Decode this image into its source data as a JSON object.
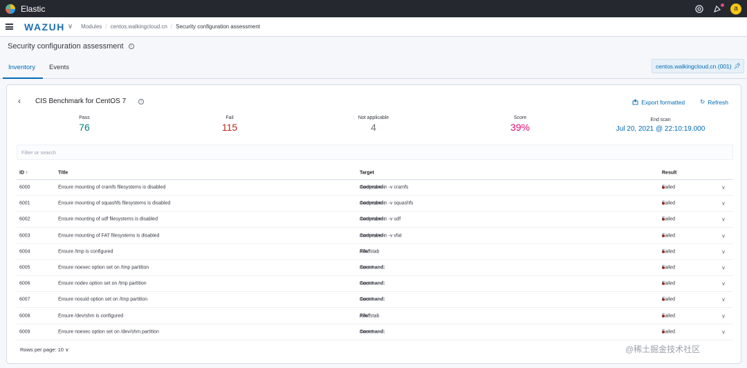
{
  "topbar": {
    "title": "Elastic",
    "avatar_initial": "a"
  },
  "header": {
    "brand": "WAZUH",
    "breadcrumbs": [
      "Modules",
      "centos.walkingcloud.cn",
      "Security configuration assessment"
    ]
  },
  "page": {
    "title": "Security configuration assessment"
  },
  "tabs": [
    {
      "label": "Inventory",
      "active": true
    },
    {
      "label": "Events",
      "active": false
    }
  ],
  "agent": {
    "label": "centos.walkingcloud.cn (001)"
  },
  "panel": {
    "title": "CIS Benchmark for CentOS 7",
    "export_label": "Export formatted",
    "refresh_label": "Refresh",
    "stats": {
      "pass_label": "Pass",
      "pass_value": "76",
      "fail_label": "Fail",
      "fail_value": "115",
      "na_label": "Not applicable",
      "na_value": "4",
      "score_label": "Score",
      "score_value": "39%",
      "end_label": "End scan",
      "end_value": "Jul 20, 2021 @ 22:10:19.000"
    },
    "filter_placeholder": "Filter or search"
  },
  "table": {
    "headers": {
      "id": "ID ↑",
      "title": "Title",
      "target": "Target",
      "result": "Result"
    },
    "rows": [
      {
        "id": "6000",
        "title": "Ensure mounting of cramfs filesystems is disabled",
        "target_label": "Command:",
        "target_value": "modprobe -n -v cramfs",
        "result": "Failed"
      },
      {
        "id": "6001",
        "title": "Ensure mounting of squashfs filesystems is disabled",
        "target_label": "Command:",
        "target_value": "modprobe -n -v squashfs",
        "result": "Failed"
      },
      {
        "id": "6002",
        "title": "Ensure mounting of udf filesystems is disabled",
        "target_label": "Command:",
        "target_value": "modprobe -n -v udf",
        "result": "Failed"
      },
      {
        "id": "6003",
        "title": "Ensure mounting of FAT filesystems is disabled",
        "target_label": "Command:",
        "target_value": "modprobe -n -v vfat",
        "result": "Failed"
      },
      {
        "id": "6004",
        "title": "Ensure /tmp is configured",
        "target_label": "File:",
        "target_value": "/etc/fstab",
        "result": "Failed"
      },
      {
        "id": "6005",
        "title": "Ensure noexec option set on /tmp partition",
        "target_label": "Command:",
        "target_value": "mount",
        "result": "Failed"
      },
      {
        "id": "6006",
        "title": "Ensure nodev option set on /tmp partition",
        "target_label": "Command:",
        "target_value": "mount",
        "result": "Failed"
      },
      {
        "id": "6007",
        "title": "Ensure nosuid option set on /tmp partition",
        "target_label": "Command:",
        "target_value": "mount",
        "result": "Failed"
      },
      {
        "id": "6008",
        "title": "Ensure /dev/shm is configured",
        "target_label": "File:",
        "target_value": "/etc/fstab",
        "result": "Failed"
      },
      {
        "id": "6009",
        "title": "Ensure noexec option set on /dev/shm partition",
        "target_label": "Command:",
        "target_value": "mount",
        "result": "Failed"
      }
    ]
  },
  "pagination": {
    "rows_per_page": "Rows per page: 10"
  },
  "watermark": "@稀土掘金技术社区"
}
